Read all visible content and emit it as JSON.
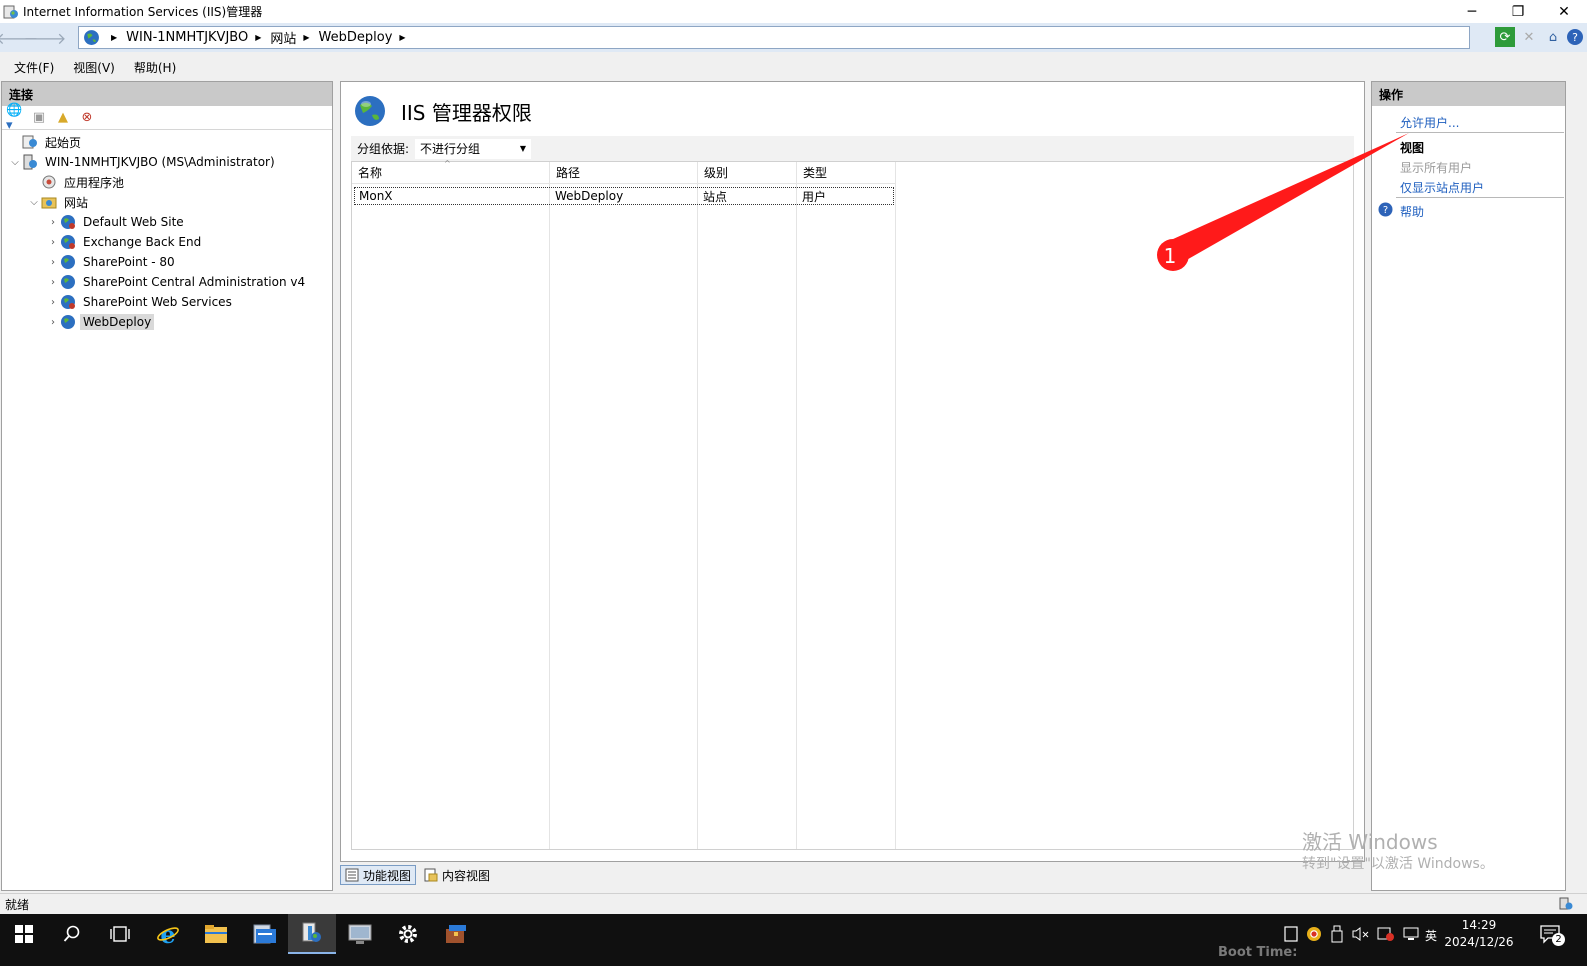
{
  "window": {
    "title": "Internet Information Services (IIS)管理器"
  },
  "address": {
    "crumbs": [
      "WIN-1NMHTJKVJBO",
      "网站",
      "WebDeploy"
    ]
  },
  "menu": {
    "file": "文件(F)",
    "view": "视图(V)",
    "help": "帮助(H)"
  },
  "connections": {
    "header": "连接",
    "tree": [
      {
        "label": "起始页",
        "icon": "start-page-icon"
      },
      {
        "label": "WIN-1NMHTJKVJBO (MS\\Administrator)",
        "icon": "server-icon"
      },
      {
        "label": "应用程序池",
        "icon": "app-pool-icon"
      },
      {
        "label": "网站",
        "icon": "sites-folder-icon"
      },
      {
        "label": "Default Web Site",
        "icon": "site-globe-icon"
      },
      {
        "label": "Exchange Back End",
        "icon": "site-globe-icon"
      },
      {
        "label": "SharePoint - 80",
        "icon": "site-globe-icon"
      },
      {
        "label": "SharePoint Central Administration v4",
        "icon": "site-globe-icon"
      },
      {
        "label": "SharePoint Web Services",
        "icon": "site-globe-icon"
      },
      {
        "label": "WebDeploy",
        "icon": "site-globe-icon",
        "selected": true
      }
    ]
  },
  "feature": {
    "title": "IIS 管理器权限",
    "group_label": "分组依据:",
    "group_value": "不进行分组",
    "columns": [
      "名称",
      "路径",
      "级别",
      "类型"
    ],
    "rows": [
      [
        "MonX",
        "WebDeploy",
        "站点",
        "用户"
      ]
    ]
  },
  "view_tabs": {
    "features": "功能视图",
    "content": "内容视图"
  },
  "actions": {
    "header": "操作",
    "allow_user": "允许用户...",
    "view_heading": "视图",
    "show_all_users": "显示所有用户",
    "show_site_users": "仅显示站点用户",
    "help": "帮助"
  },
  "annotation": {
    "badge": "1",
    "color": "#ff1a1a"
  },
  "status": {
    "text": "就绪"
  },
  "watermark": {
    "line1": "激活 Windows",
    "line2": "转到\"设置\"以激活 Windows。"
  },
  "taskbar": {
    "time": "14:29",
    "date": "2024/12/26",
    "ime": "英",
    "notifications": "2",
    "background_text": "Boot Time:"
  }
}
